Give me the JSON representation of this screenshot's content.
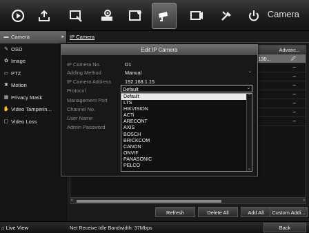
{
  "toolbar": {
    "title": "Camera",
    "icons": [
      "playback-icon",
      "export-icon",
      "manual-icon",
      "hdd-icon",
      "record-icon",
      "camera-icon",
      "event-icon",
      "maintenance-icon",
      "shutdown-icon"
    ],
    "active": "camera-icon"
  },
  "sidebar": {
    "items": [
      {
        "label": "Camera",
        "icon": "camera-icon",
        "glyph": "▬",
        "active": true
      },
      {
        "label": "OSD",
        "icon": "osd-icon",
        "glyph": "✎",
        "active": false
      },
      {
        "label": "Image",
        "icon": "image-icon",
        "glyph": "✿",
        "active": false
      },
      {
        "label": "PTZ",
        "icon": "ptz-icon",
        "glyph": "▭",
        "active": false
      },
      {
        "label": "Motion",
        "icon": "motion-icon",
        "glyph": "✱",
        "active": false
      },
      {
        "label": "Privacy Mask",
        "icon": "privacy-mask-icon",
        "glyph": "▦",
        "active": false
      },
      {
        "label": "Video Tamperin...",
        "icon": "video-tampering-icon",
        "glyph": "✋",
        "active": false
      },
      {
        "label": "Video Loss",
        "icon": "video-loss-icon",
        "glyph": "▢",
        "active": false
      }
    ]
  },
  "main": {
    "tab": "IP Camera",
    "grid": {
      "header_advanced": "Advanc...",
      "selected_row_ip": "ild 130...",
      "row_dash": "–"
    },
    "buttons": {
      "refresh": "Refresh",
      "delete_all": "Delete All",
      "add_all": "Add All",
      "custom_add": "Custom Addi..."
    }
  },
  "dialog": {
    "title": "Edit IP Camera",
    "fields": [
      {
        "label": "IP Camera No.",
        "value": "D1"
      },
      {
        "label": "Adding Method",
        "value": "Manual"
      },
      {
        "label": "IP Camera Address",
        "value": "192.168.1.15"
      },
      {
        "label": "Protocol",
        "value": "Default"
      },
      {
        "label": "Management Port",
        "value": ""
      },
      {
        "label": "Channel No.",
        "value": ""
      },
      {
        "label": "User Name",
        "value": ""
      },
      {
        "label": "Admin Password",
        "value": ""
      }
    ],
    "protocol_options": [
      "Default",
      "LTS",
      "HIKVISION",
      "ACTi",
      "ARECONT",
      "AXIS",
      "BOSCH",
      "BRICKCOM",
      "CANON",
      "ONVIF",
      "PANASONIC",
      "PELCO"
    ],
    "protocol_highlighted": "Default"
  },
  "status": {
    "live_view": "Live View",
    "bandwidth": "Net Receive Idle Bandwidth: 37Mbps",
    "back": "Back"
  }
}
